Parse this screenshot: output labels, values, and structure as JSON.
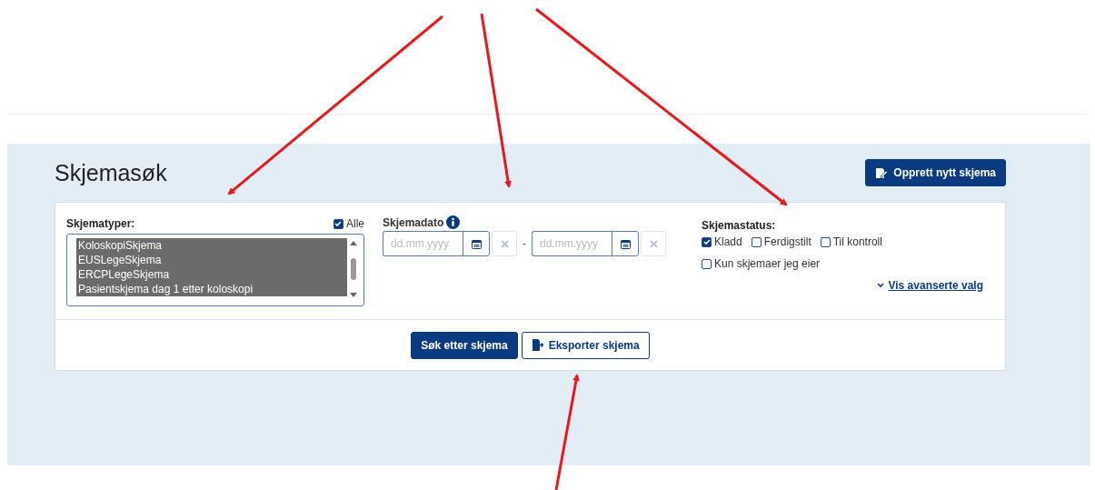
{
  "page": {
    "title": "Skjemasøk",
    "create_button": "Opprett nytt skjema"
  },
  "types": {
    "label": "Skjematyper:",
    "all": {
      "label": "Alle",
      "checked": true
    },
    "items": [
      {
        "label": "KoloskopiSkjema",
        "selected": true
      },
      {
        "label": "EUSLegeSkjema",
        "selected": true
      },
      {
        "label": "ERCPLegeSkjema",
        "selected": true
      },
      {
        "label": "Pasientskjema dag 1 etter koloskopi",
        "selected": true
      }
    ]
  },
  "date": {
    "label": "Skjemadato",
    "separator": "-",
    "from": {
      "placeholder": "dd.mm.yyyy"
    },
    "to": {
      "placeholder": "dd.mm.yyyy"
    }
  },
  "status": {
    "label": "Skjemastatus:",
    "options": [
      {
        "label": "Kladd",
        "checked": true
      },
      {
        "label": "Ferdigstilt",
        "checked": false
      },
      {
        "label": "Til kontroll",
        "checked": false
      }
    ],
    "own": {
      "label": "Kun skjemaer jeg eier",
      "checked": false
    },
    "advanced": "Vis avanserte valg"
  },
  "actions": {
    "search": "Søk etter skjema",
    "export": "Eksporter skjema"
  },
  "annotations": [
    {
      "kind": "arrow"
    },
    {
      "kind": "arrow"
    },
    {
      "kind": "arrow"
    },
    {
      "kind": "arrow"
    }
  ]
}
